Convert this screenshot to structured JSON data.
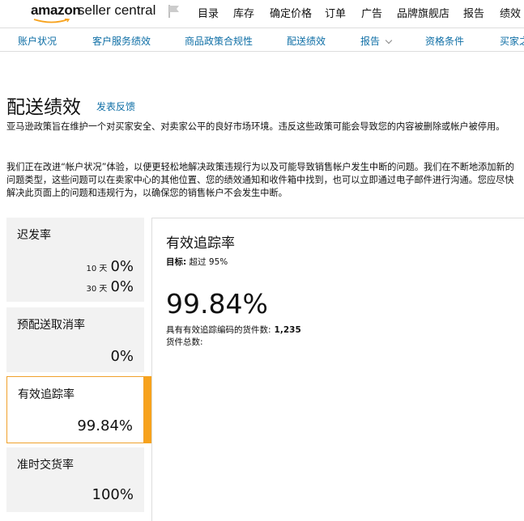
{
  "header": {
    "logo_amazon": "amazon",
    "logo_seller": "seller central",
    "nav": [
      "目录",
      "库存",
      "确定价格",
      "订单",
      "广告",
      "品牌旗舰店",
      "报告",
      "绩效"
    ]
  },
  "subnav": {
    "items": [
      "账户状况",
      "客户服务绩效",
      "商品政策合规性",
      "配送绩效",
      "报告",
      "资格条件",
      "买家之声"
    ]
  },
  "page": {
    "title": "配送绩效",
    "feedback": "发表反馈",
    "para1": "亚马逊政策旨在维护一个对买家安全、对卖家公平的良好市场环境。违反这些政策可能会导致您的内容被删除或帐户被停用。",
    "para2": "我们正在改进“帐户状况”体验，以便更轻松地解决政策违规行为以及可能导致销售帐户发生中断的问题。我们在不断地添加新的问题类型，这些问题可以在卖家中心的其他位置、您的绩效通知和收件箱中找到，也可以立即通过电子邮件进行沟通。您应尽快解决此页面上的问题和违规行为，以确保您的销售帐户不会发生中断。"
  },
  "cards": {
    "late": {
      "title": "迟发率",
      "p10": "10 天",
      "v10": "0%",
      "p30": "30 天",
      "v30": "0%"
    },
    "cancel": {
      "title": "预配送取消率",
      "value": "0%"
    },
    "tracking": {
      "title": "有效追踪率",
      "value": "99.84%"
    },
    "ontime": {
      "title": "准时交货率",
      "value": "100%"
    }
  },
  "panel": {
    "title": "有效追踪率",
    "target_label": "目标:",
    "target_value": "超过 95%",
    "big_value": "99.84%",
    "tracked_label": "具有有效追踪编码的货件数:",
    "tracked_value": "1,235",
    "total_label": "货件总数:",
    "total_value": ""
  },
  "colors": {
    "link": "#0f6fa6",
    "accent": "#f7a21c",
    "card_bg": "#f2f2f2"
  },
  "icons": {
    "flag": "flag-icon",
    "dropdown": "chevron-down-icon"
  }
}
